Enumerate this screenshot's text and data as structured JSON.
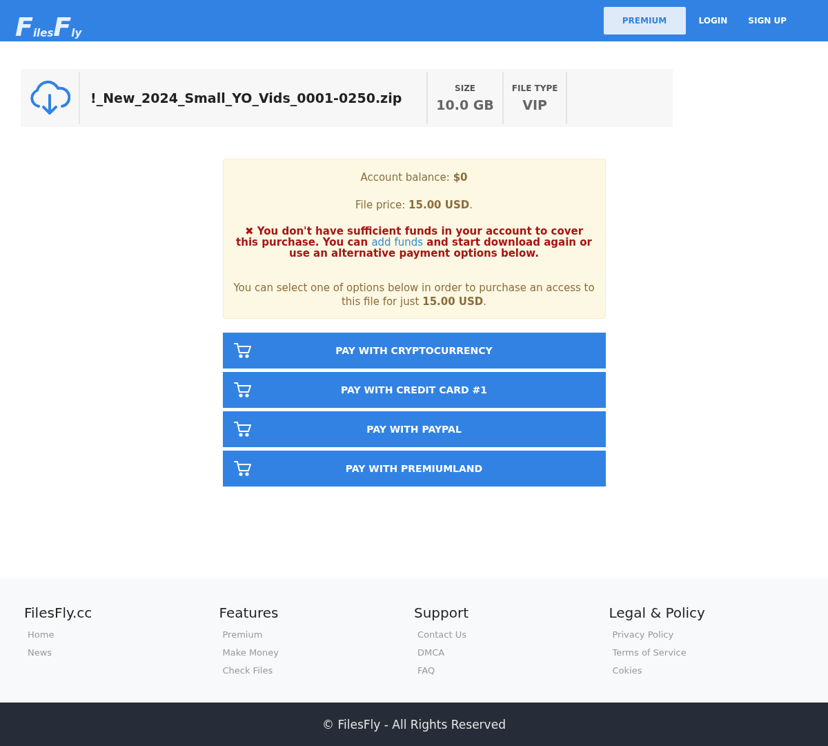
{
  "header": {
    "logo_parts": [
      "F",
      "iles",
      "F",
      "ly"
    ],
    "nav": [
      {
        "label": "PREMIUM",
        "selected": true
      },
      {
        "label": "LOGIN",
        "selected": false
      },
      {
        "label": "SIGN UP",
        "selected": false
      }
    ]
  },
  "file": {
    "name": "!_New_2024_Small_YO_Vids_0001-0250.zip",
    "stats": [
      {
        "label": "SIZE",
        "value": "10.0 GB"
      },
      {
        "label": "FILE TYPE",
        "value": "VIP"
      }
    ]
  },
  "notice": {
    "balance": "Account balance: **$0**",
    "price": "File price: **15.00 USD**.",
    "error": {
      "icon": "✖",
      "before": "You don't have sufficient funds in your account to cover this purchase. You can",
      "link": "add funds",
      "after": "and start download again or use an alternative payment options below."
    },
    "options": "You can select one of options below in order to purchase an access to this file for just **15.00 USD**."
  },
  "payment_buttons": [
    "PAY WITH CRYPTOCURRENCY",
    "PAY WITH CREDIT CARD #1",
    "PAY WITH PAYPAL",
    "PAY WITH PREMIUMLAND"
  ],
  "footer": {
    "columns": [
      {
        "title": "FilesFly.cc",
        "links": [
          "Home",
          "News"
        ]
      },
      {
        "title": "Features",
        "links": [
          "Premium",
          "Make Money",
          "Check Files"
        ]
      },
      {
        "title": "Support",
        "links": [
          "Contact Us",
          "DMCA",
          "FAQ"
        ]
      },
      {
        "title": "Legal & Policy",
        "links": [
          "Privacy Policy",
          "Terms of Service",
          "Cokies"
        ]
      }
    ],
    "copyright": "© FilesFly - All Rights Reserved"
  }
}
